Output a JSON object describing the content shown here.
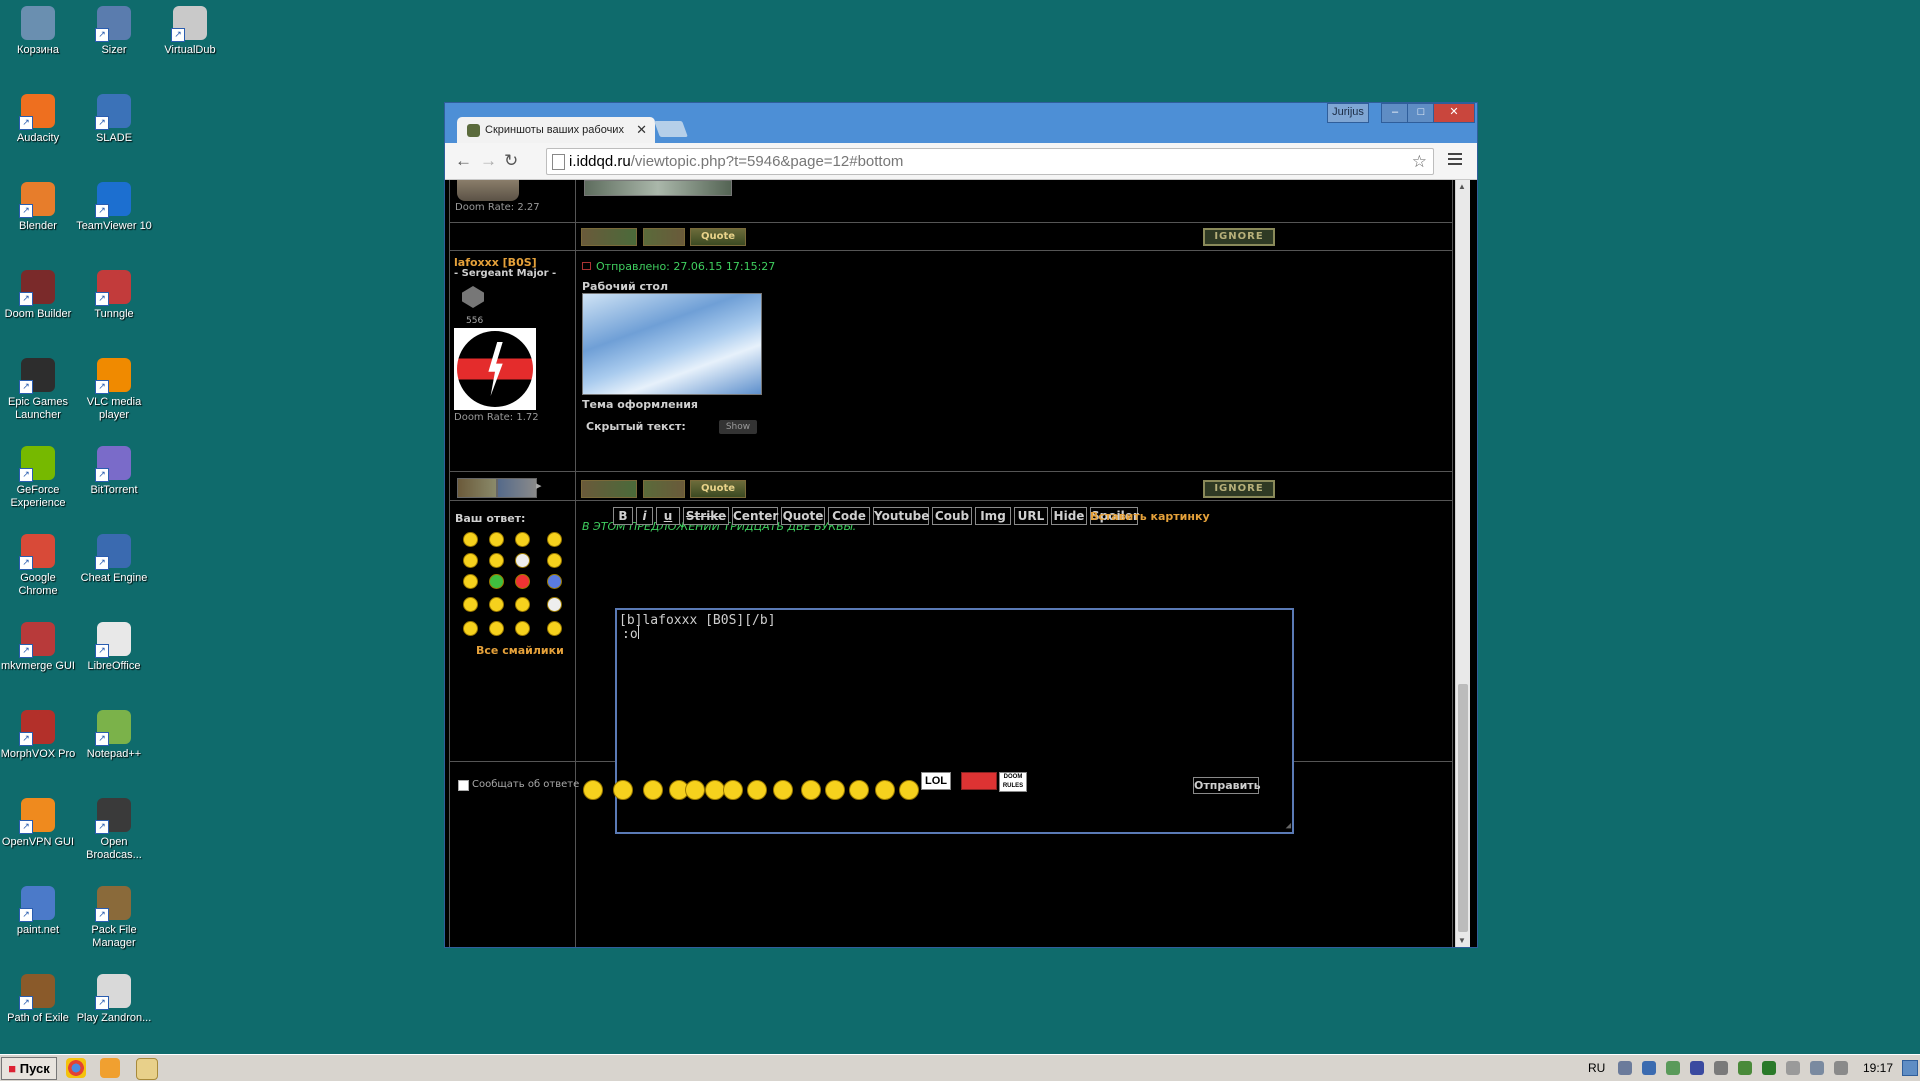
{
  "desktop": {
    "icons": [
      {
        "label": "Корзина",
        "color": "#6a8fb0"
      },
      {
        "label": "Sizer",
        "color": "#5a7cae"
      },
      {
        "label": "VirtualDub",
        "color": "#c9c9c9"
      },
      {
        "label": "Audacity",
        "color": "#ee6f1f"
      },
      {
        "label": "SLADE",
        "color": "#3b72b8"
      },
      {
        "label": "Blender",
        "color": "#e77d2b"
      },
      {
        "label": "TeamViewer 10",
        "color": "#1c6fd0"
      },
      {
        "label": "Doom Builder",
        "color": "#7a2a2a"
      },
      {
        "label": "Tunngle",
        "color": "#c23b3b"
      },
      {
        "label": "Epic Games Launcher",
        "color": "#2d2d2d"
      },
      {
        "label": "VLC media player",
        "color": "#f08a00"
      },
      {
        "label": "GeForce Experience",
        "color": "#76b900"
      },
      {
        "label": "BitTorrent",
        "color": "#7a6bc9"
      },
      {
        "label": "Google Chrome",
        "color": "#d84a38"
      },
      {
        "label": "Cheat Engine",
        "color": "#3a6ab0"
      },
      {
        "label": "mkvmerge GUI",
        "color": "#b83a3a"
      },
      {
        "label": "LibreOffice",
        "color": "#e8e8e8"
      },
      {
        "label": "MorphVOX Pro",
        "color": "#b3302a"
      },
      {
        "label": "Notepad++",
        "color": "#7bb24a"
      },
      {
        "label": "OpenVPN GUI",
        "color": "#ef8a1e"
      },
      {
        "label": "Open Broadcas...",
        "color": "#3a3a3a"
      },
      {
        "label": "paint.net",
        "color": "#4b7ac9"
      },
      {
        "label": "Pack File Manager",
        "color": "#8a6a3a"
      },
      {
        "label": "Path of Exile",
        "color": "#8a5a2a"
      },
      {
        "label": "Play Zandron...",
        "color": "#d9d9d9"
      }
    ]
  },
  "browser": {
    "user_badge": "Jurijus",
    "tab_title": "Скриншоты ваших рабочих",
    "url_host": "i.iddqd.ru",
    "url_path": "/viewtopic.php?t=5946&page=12#bottom"
  },
  "forum": {
    "prev_post": {
      "doom_rate": "Doom Rate: 2.27"
    },
    "post": {
      "author": "lafoxxx [B0S]",
      "rank": "- Sergeant Major -",
      "rank_count": "556",
      "doom_rate": "Doom Rate: 1.72",
      "sent": "Отправлено: 27.06.15 17:15:27",
      "caption1": "Рабочий стол",
      "caption2": "Тема оформления",
      "hidden_label": "Скрытый текст:",
      "show_button": "Show",
      "signature": "В ЭТОМ ПРЕДЛОЖЕНИИ ТРИДЦАТЬ ДВЕ БУКВЫ."
    },
    "post_buttons": {
      "quote": "Quote",
      "ignore": "IGNORE"
    },
    "reply": {
      "label": "Ваш ответ:",
      "all_smileys": "Все смайлики",
      "editor_buttons": [
        "B",
        "i",
        "u",
        "Strike",
        "Center",
        "Quote",
        "Code",
        "Youtube",
        "Coub",
        "Img",
        "URL",
        "Hide",
        "Spoiler"
      ],
      "insert_image": "Вставить картинку",
      "textarea_line1": "[b]lafoxxx [B0S][/b]",
      "textarea_line2": ":o",
      "notify_label": "Сообщать об ответе",
      "submit": "Отправить",
      "lol_badge": "LOL",
      "doom_badge": "DOOM RULES"
    }
  },
  "taskbar": {
    "start": "Пуск",
    "lang": "RU",
    "clock": "19:17"
  }
}
